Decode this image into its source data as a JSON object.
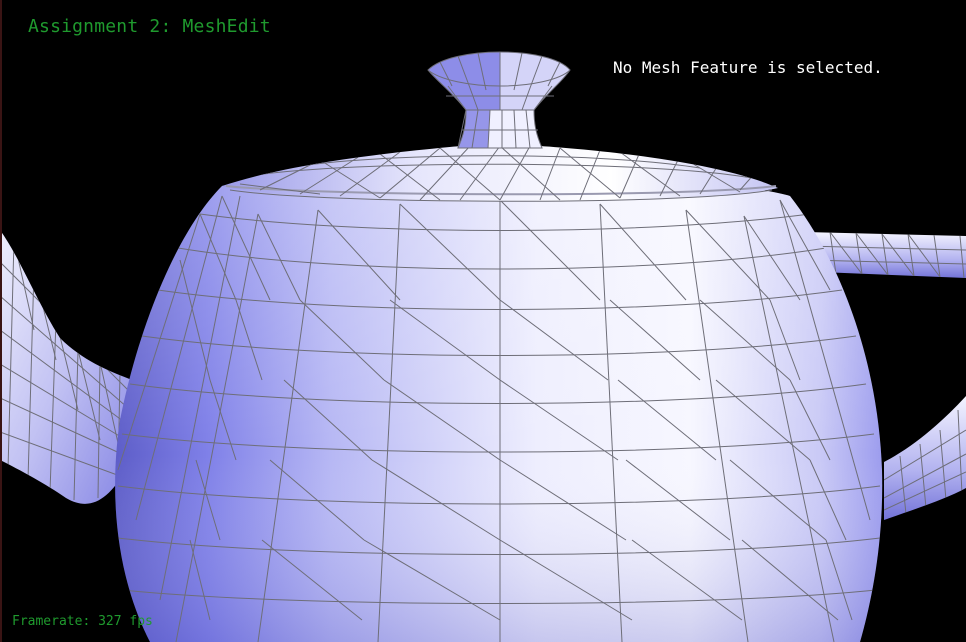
{
  "window": {
    "title": "Assignment 2: MeshEdit",
    "status_message": "No Mesh Feature is selected.",
    "framerate_label": "Framerate: 327 fps"
  },
  "viewport": {
    "background": "#000000",
    "mesh_object": "teapot",
    "render_mode": "flat-shaded triangle mesh with wireframe",
    "colors": {
      "mesh_light": "#f4f4ff",
      "mesh_mid": "#b8b8f2",
      "mesh_dark": "#7c7ce6",
      "wireframe": "#6e6e78",
      "label_green": "#1f9a2e",
      "label_white": "#ffffff"
    }
  }
}
